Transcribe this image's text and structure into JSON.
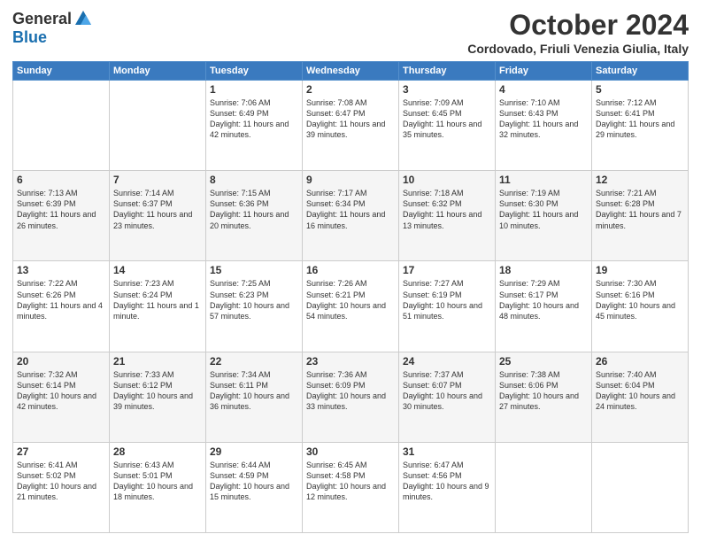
{
  "logo": {
    "general": "General",
    "blue": "Blue"
  },
  "title": "October 2024",
  "location": "Cordovado, Friuli Venezia Giulia, Italy",
  "days_header": [
    "Sunday",
    "Monday",
    "Tuesday",
    "Wednesday",
    "Thursday",
    "Friday",
    "Saturday"
  ],
  "weeks": [
    [
      {
        "day": "",
        "info": ""
      },
      {
        "day": "",
        "info": ""
      },
      {
        "day": "1",
        "info": "Sunrise: 7:06 AM\nSunset: 6:49 PM\nDaylight: 11 hours and 42 minutes."
      },
      {
        "day": "2",
        "info": "Sunrise: 7:08 AM\nSunset: 6:47 PM\nDaylight: 11 hours and 39 minutes."
      },
      {
        "day": "3",
        "info": "Sunrise: 7:09 AM\nSunset: 6:45 PM\nDaylight: 11 hours and 35 minutes."
      },
      {
        "day": "4",
        "info": "Sunrise: 7:10 AM\nSunset: 6:43 PM\nDaylight: 11 hours and 32 minutes."
      },
      {
        "day": "5",
        "info": "Sunrise: 7:12 AM\nSunset: 6:41 PM\nDaylight: 11 hours and 29 minutes."
      }
    ],
    [
      {
        "day": "6",
        "info": "Sunrise: 7:13 AM\nSunset: 6:39 PM\nDaylight: 11 hours and 26 minutes."
      },
      {
        "day": "7",
        "info": "Sunrise: 7:14 AM\nSunset: 6:37 PM\nDaylight: 11 hours and 23 minutes."
      },
      {
        "day": "8",
        "info": "Sunrise: 7:15 AM\nSunset: 6:36 PM\nDaylight: 11 hours and 20 minutes."
      },
      {
        "day": "9",
        "info": "Sunrise: 7:17 AM\nSunset: 6:34 PM\nDaylight: 11 hours and 16 minutes."
      },
      {
        "day": "10",
        "info": "Sunrise: 7:18 AM\nSunset: 6:32 PM\nDaylight: 11 hours and 13 minutes."
      },
      {
        "day": "11",
        "info": "Sunrise: 7:19 AM\nSunset: 6:30 PM\nDaylight: 11 hours and 10 minutes."
      },
      {
        "day": "12",
        "info": "Sunrise: 7:21 AM\nSunset: 6:28 PM\nDaylight: 11 hours and 7 minutes."
      }
    ],
    [
      {
        "day": "13",
        "info": "Sunrise: 7:22 AM\nSunset: 6:26 PM\nDaylight: 11 hours and 4 minutes."
      },
      {
        "day": "14",
        "info": "Sunrise: 7:23 AM\nSunset: 6:24 PM\nDaylight: 11 hours and 1 minute."
      },
      {
        "day": "15",
        "info": "Sunrise: 7:25 AM\nSunset: 6:23 PM\nDaylight: 10 hours and 57 minutes."
      },
      {
        "day": "16",
        "info": "Sunrise: 7:26 AM\nSunset: 6:21 PM\nDaylight: 10 hours and 54 minutes."
      },
      {
        "day": "17",
        "info": "Sunrise: 7:27 AM\nSunset: 6:19 PM\nDaylight: 10 hours and 51 minutes."
      },
      {
        "day": "18",
        "info": "Sunrise: 7:29 AM\nSunset: 6:17 PM\nDaylight: 10 hours and 48 minutes."
      },
      {
        "day": "19",
        "info": "Sunrise: 7:30 AM\nSunset: 6:16 PM\nDaylight: 10 hours and 45 minutes."
      }
    ],
    [
      {
        "day": "20",
        "info": "Sunrise: 7:32 AM\nSunset: 6:14 PM\nDaylight: 10 hours and 42 minutes."
      },
      {
        "day": "21",
        "info": "Sunrise: 7:33 AM\nSunset: 6:12 PM\nDaylight: 10 hours and 39 minutes."
      },
      {
        "day": "22",
        "info": "Sunrise: 7:34 AM\nSunset: 6:11 PM\nDaylight: 10 hours and 36 minutes."
      },
      {
        "day": "23",
        "info": "Sunrise: 7:36 AM\nSunset: 6:09 PM\nDaylight: 10 hours and 33 minutes."
      },
      {
        "day": "24",
        "info": "Sunrise: 7:37 AM\nSunset: 6:07 PM\nDaylight: 10 hours and 30 minutes."
      },
      {
        "day": "25",
        "info": "Sunrise: 7:38 AM\nSunset: 6:06 PM\nDaylight: 10 hours and 27 minutes."
      },
      {
        "day": "26",
        "info": "Sunrise: 7:40 AM\nSunset: 6:04 PM\nDaylight: 10 hours and 24 minutes."
      }
    ],
    [
      {
        "day": "27",
        "info": "Sunrise: 6:41 AM\nSunset: 5:02 PM\nDaylight: 10 hours and 21 minutes."
      },
      {
        "day": "28",
        "info": "Sunrise: 6:43 AM\nSunset: 5:01 PM\nDaylight: 10 hours and 18 minutes."
      },
      {
        "day": "29",
        "info": "Sunrise: 6:44 AM\nSunset: 4:59 PM\nDaylight: 10 hours and 15 minutes."
      },
      {
        "day": "30",
        "info": "Sunrise: 6:45 AM\nSunset: 4:58 PM\nDaylight: 10 hours and 12 minutes."
      },
      {
        "day": "31",
        "info": "Sunrise: 6:47 AM\nSunset: 4:56 PM\nDaylight: 10 hours and 9 minutes."
      },
      {
        "day": "",
        "info": ""
      },
      {
        "day": "",
        "info": ""
      }
    ]
  ]
}
